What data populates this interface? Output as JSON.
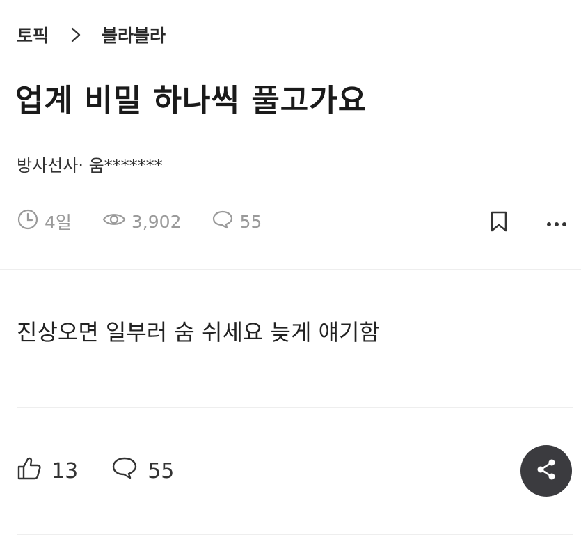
{
  "breadcrumb": {
    "root": "토픽",
    "current": "블라블라"
  },
  "post": {
    "title": "업계 비밀 하나씩 풀고가요",
    "author": "방사선사· 움*******",
    "time_ago": "4일",
    "views": "3,902",
    "comments": "55",
    "body": "진상오면 일부러 숨 쉬세요 늦게 얘기함"
  },
  "reactions": {
    "likes": "13",
    "comments": "55"
  },
  "icons": {
    "separator": "chevron-right-icon",
    "time": "clock-icon",
    "views": "eye-icon",
    "comments": "speech-bubble-icon",
    "bookmark": "bookmark-icon",
    "more": "more-horizontal-icon",
    "like": "thumbs-up-icon",
    "share": "share-icon"
  },
  "colors": {
    "meta_gray": "#9a9a9a",
    "share_button_bg": "#3b3b3f",
    "divider": "#eeeeee"
  }
}
